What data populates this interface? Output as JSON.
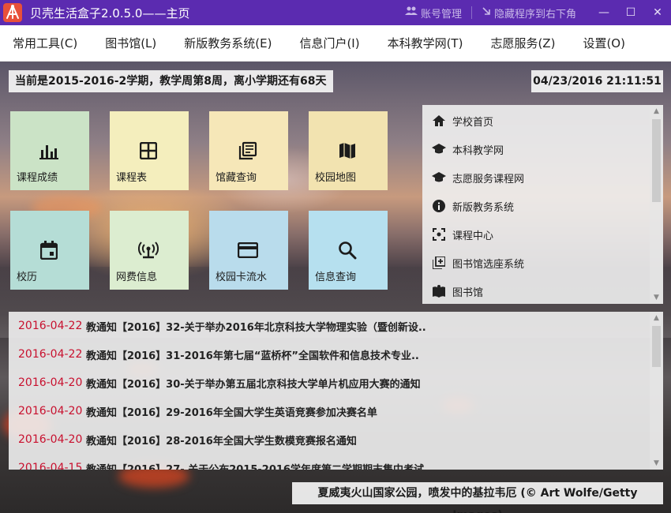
{
  "window": {
    "title": "贝壳生活盒子2.0.5.0——主页",
    "account_label": "账号管理",
    "hide_label": "隐藏程序到右下角",
    "minimize": "—",
    "maximize": "☐",
    "close": "✕",
    "brand_color": "#5b2bb0"
  },
  "menu": [
    {
      "label": "常用工具(C)"
    },
    {
      "label": "图书馆(L)"
    },
    {
      "label": "新版教务系统(E)"
    },
    {
      "label": "信息门户(I)"
    },
    {
      "label": "本科教学网(T)"
    },
    {
      "label": "志愿服务(Z)"
    },
    {
      "label": "设置(O)"
    }
  ],
  "status": {
    "semester": "当前是2015-2016-2学期，教学周第8周，离小学期还有68天",
    "datetime": "04/23/2016 21:11:51"
  },
  "tiles": [
    {
      "label": "课程成绩",
      "icon": "bar-chart-icon",
      "color": "#cbe3c6"
    },
    {
      "label": "课程表",
      "icon": "table-grid-icon",
      "color": "#f4eebd"
    },
    {
      "label": "馆藏查询",
      "icon": "library-books-icon",
      "color": "#f6e7b8"
    },
    {
      "label": "校园地图",
      "icon": "map-icon",
      "color": "#f2e3b0"
    },
    {
      "label": "校历",
      "icon": "calendar-icon",
      "color": "#b5ddd6"
    },
    {
      "label": "网费信息",
      "icon": "network-icon",
      "color": "#dcedd0"
    },
    {
      "label": "校园卡流水",
      "icon": "credit-card-icon",
      "color": "#b9dcec"
    },
    {
      "label": "信息查询",
      "icon": "search-icon",
      "color": "#b6e0ef"
    }
  ],
  "links": [
    {
      "label": "学校首页",
      "icon": "home-icon"
    },
    {
      "label": "本科教学网",
      "icon": "graduation-cap-icon"
    },
    {
      "label": "志愿服务课程网",
      "icon": "graduation-cap-icon"
    },
    {
      "label": "新版教务系统",
      "icon": "info-icon"
    },
    {
      "label": "课程中心",
      "icon": "center-focus-icon"
    },
    {
      "label": "图书馆选座系统",
      "icon": "add-box-icon"
    },
    {
      "label": "图书馆",
      "icon": "book-icon"
    }
  ],
  "news": [
    {
      "date": "2016-04-22",
      "title": "教通知【2016】32-关于举办2016年北京科技大学物理实验（暨创新设.."
    },
    {
      "date": "2016-04-22",
      "title": "教通知【2016】31-2016年第七届“蓝桥杯”全国软件和信息技术专业.."
    },
    {
      "date": "2016-04-20",
      "title": "教通知【2016】30-关于举办第五届北京科技大学单片机应用大赛的通知"
    },
    {
      "date": "2016-04-20",
      "title": "教通知【2016】29-2016年全国大学生英语竞赛参加决赛名单"
    },
    {
      "date": "2016-04-20",
      "title": "教通知【2016】28-2016年全国大学生数模竞赛报名通知"
    },
    {
      "date": "2016-04-15",
      "title": "教通知【2016】27- 关于公布2015-2016学年度第二学期期末集中考试"
    }
  ],
  "caption": "夏威夷火山国家公园，喷发中的基拉韦厄 (© Art Wolfe/Getty Images)",
  "colors": {
    "news_date": "#c8102e"
  }
}
